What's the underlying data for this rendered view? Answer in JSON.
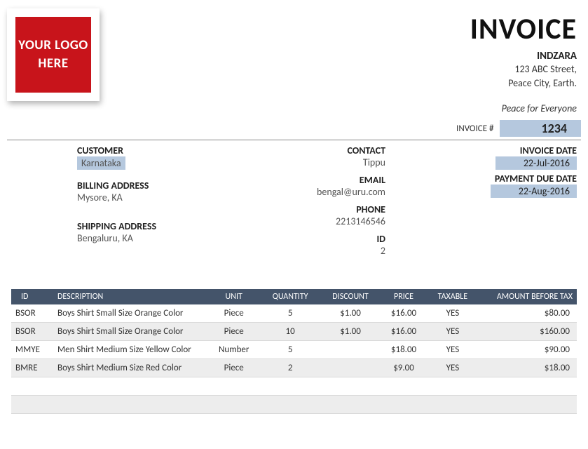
{
  "logo_text": "YOUR LOGO HERE",
  "header": {
    "title": "INVOICE",
    "company": "INDZARA",
    "addr1": "123 ABC Street,",
    "addr2": "Peace City, Earth.",
    "tagline": "Peace for Everyone",
    "invoice_num_label": "INVOICE #",
    "invoice_num": "1234"
  },
  "customer": {
    "label": "CUSTOMER",
    "value": "Karnataka",
    "billing_label": "BILLING ADDRESS",
    "billing_value": "Mysore, KA",
    "shipping_label": "SHIPPING ADDRESS",
    "shipping_value": "Bengaluru, KA"
  },
  "contact": {
    "label": "CONTACT",
    "value": "Tippu",
    "email_label": "EMAIL",
    "email_value": "bengal@uru.com",
    "phone_label": "PHONE",
    "phone_value": "2213146546",
    "id_label": "ID",
    "id_value": "2"
  },
  "dates": {
    "invoice_label": "INVOICE DATE",
    "invoice_value": "22-Jul-2016",
    "due_label": "PAYMENT DUE DATE",
    "due_value": "22-Aug-2016"
  },
  "table": {
    "headers": {
      "id": "ID",
      "desc": "DESCRIPTION",
      "unit": "UNIT",
      "qty": "QUANTITY",
      "disc": "DISCOUNT",
      "price": "PRICE",
      "tax": "TAXABLE",
      "amt": "AMOUNT BEFORE TAX"
    },
    "rows": [
      {
        "id": "BSOR",
        "desc": "Boys Shirt Small Size Orange Color",
        "unit": "Piece",
        "qty": "5",
        "disc": "$1.00",
        "price": "$16.00",
        "tax": "YES",
        "amt": "$80.00"
      },
      {
        "id": "BSOR",
        "desc": "Boys Shirt Small Size Orange Color",
        "unit": "Piece",
        "qty": "10",
        "disc": "$1.00",
        "price": "$16.00",
        "tax": "YES",
        "amt": "$160.00"
      },
      {
        "id": "MMYE",
        "desc": "Men Shirt Medium Size Yellow Color",
        "unit": "Number",
        "qty": "5",
        "disc": "",
        "price": "$18.00",
        "tax": "YES",
        "amt": "$90.00"
      },
      {
        "id": "BMRE",
        "desc": "Boys Shirt Medium Size Red Color",
        "unit": "Piece",
        "qty": "2",
        "disc": "",
        "price": "$9.00",
        "tax": "YES",
        "amt": "$18.00"
      }
    ]
  }
}
